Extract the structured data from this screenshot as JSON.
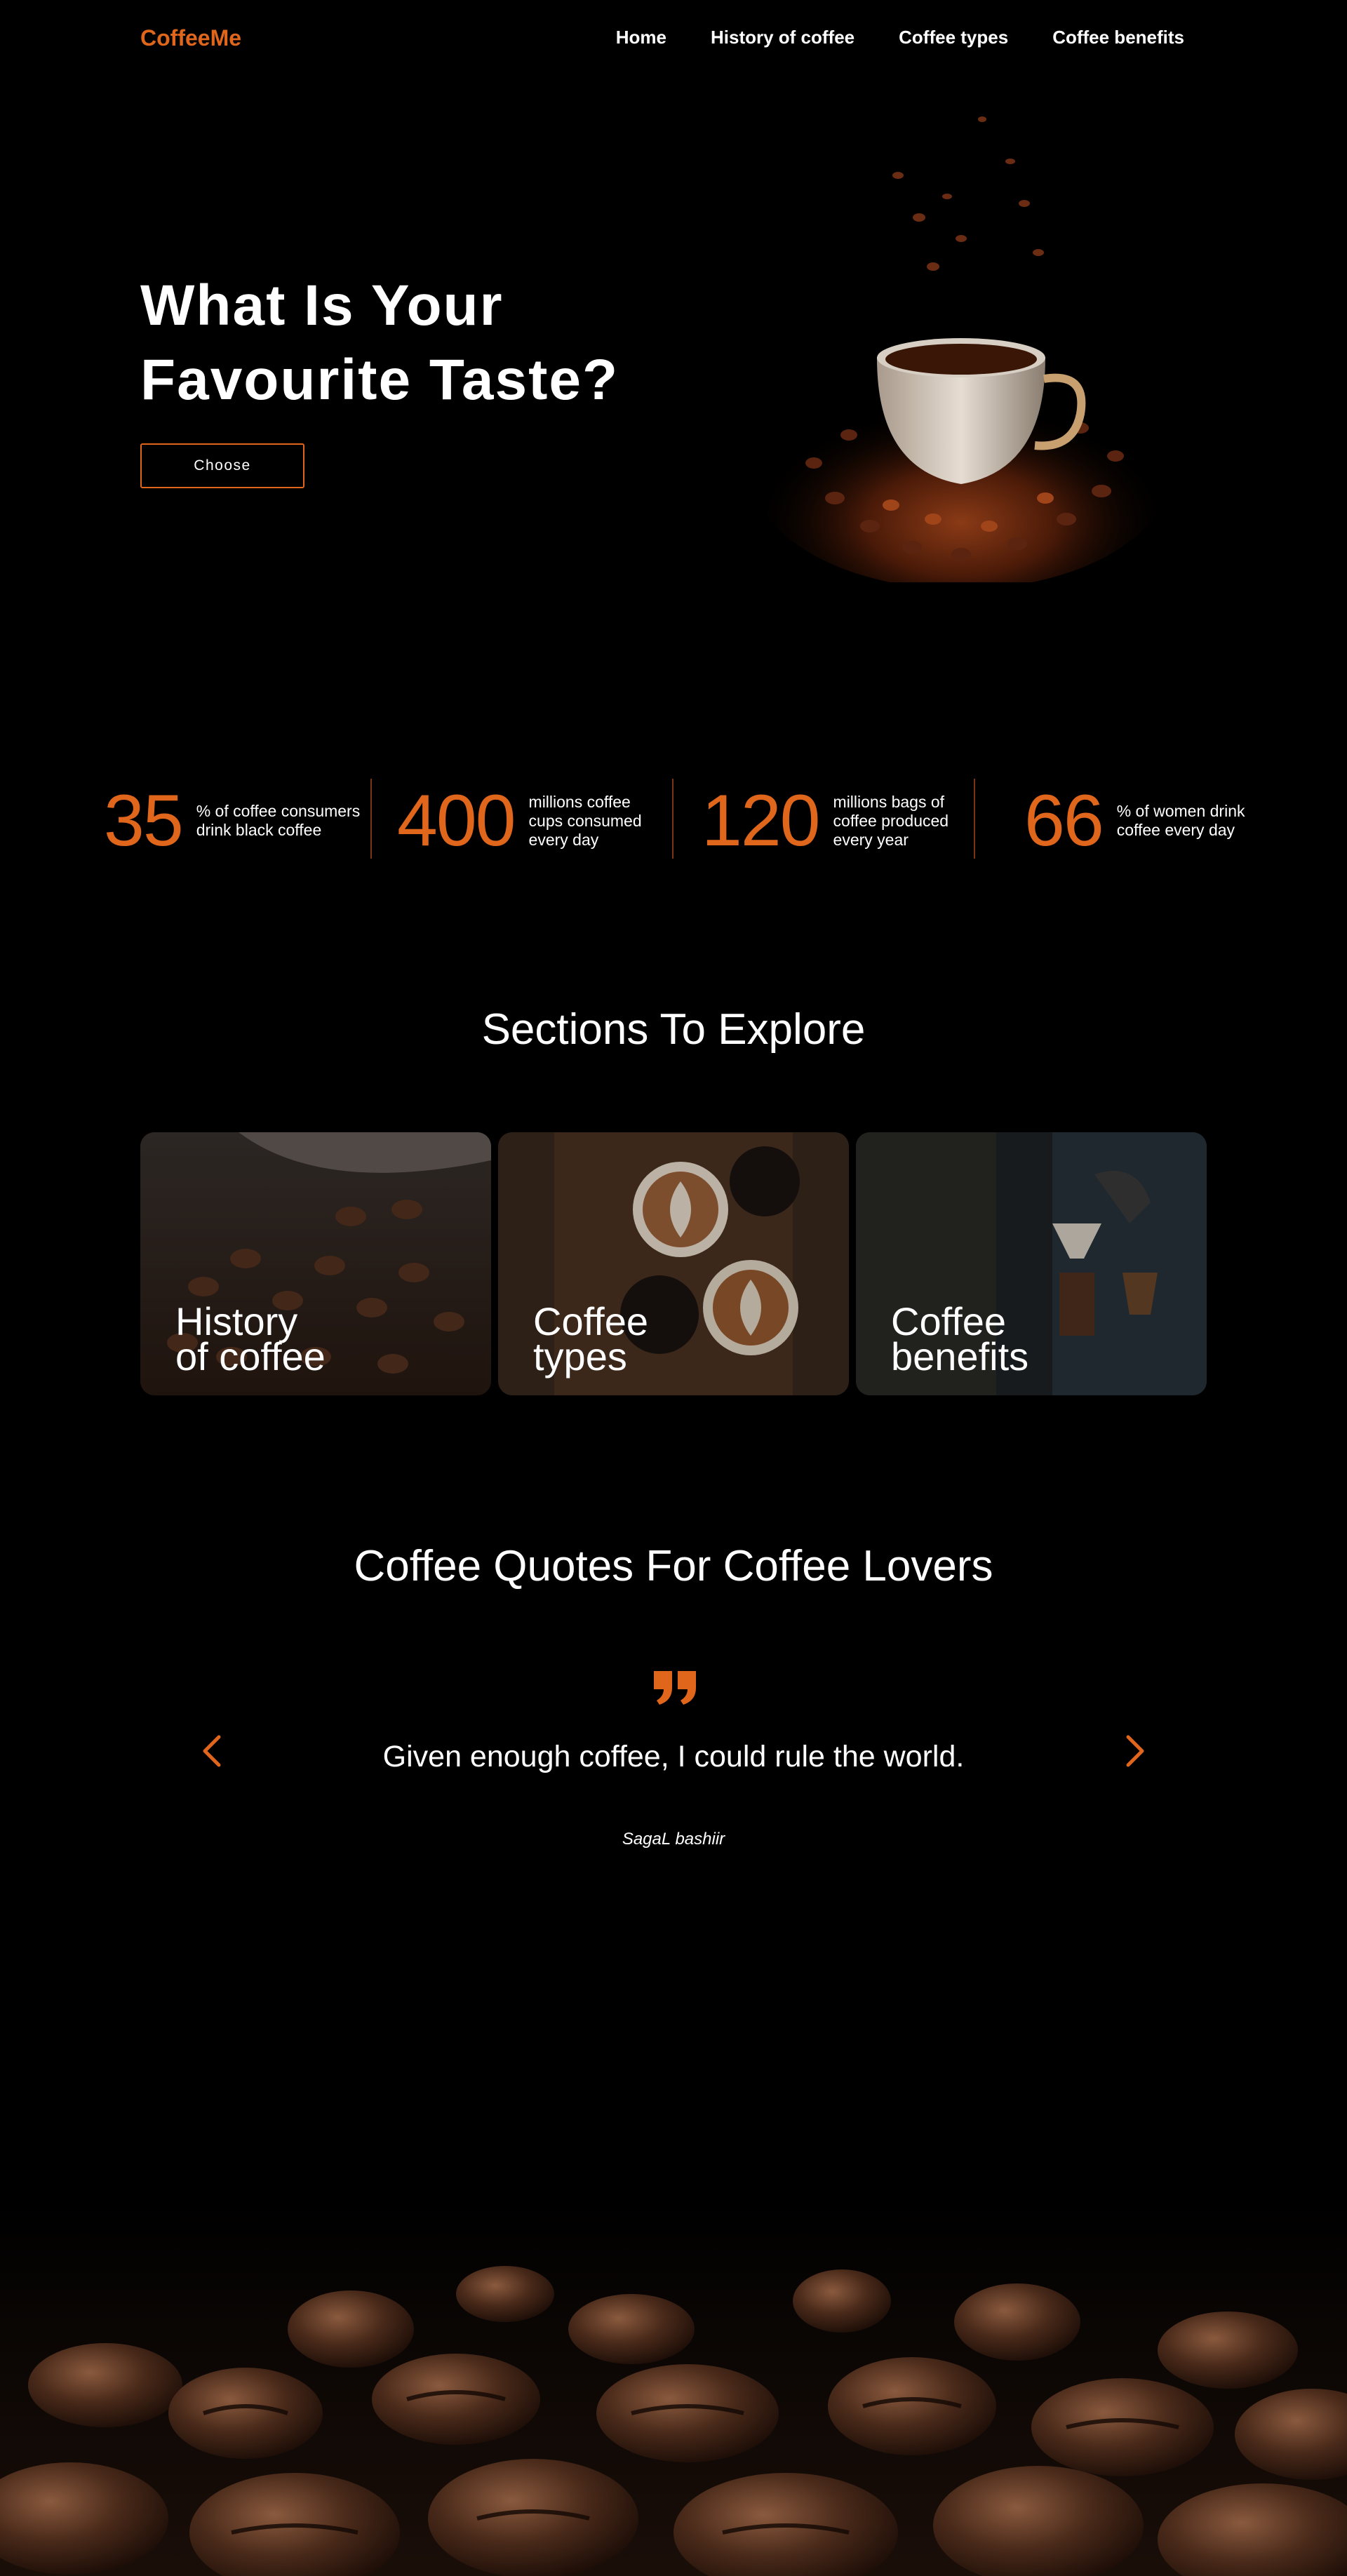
{
  "nav": {
    "brand": "CoffeeMe",
    "links": [
      "Home",
      "History of coffee",
      "Coffee types",
      "Coffee benefits"
    ]
  },
  "hero": {
    "title_line1": "What Is Your",
    "title_line2": "Favourite Taste?",
    "button_label": "Choose"
  },
  "stats": [
    {
      "value": "35",
      "text": "% of coffee consumers drink black coffee"
    },
    {
      "value": "400",
      "text": "millions coffee cups consumed every day"
    },
    {
      "value": "120",
      "text": "millions bags of coffee produced every year"
    },
    {
      "value": "66",
      "text": "% of women drink coffee every day"
    }
  ],
  "sections": {
    "title": "Sections To Explore",
    "cards": [
      {
        "line1": "History",
        "line2": "of coffee"
      },
      {
        "line1": "Coffee",
        "line2": "types"
      },
      {
        "line1": "Coffee",
        "line2": "benefits"
      }
    ]
  },
  "quotes": {
    "title": "Coffee Quotes For Coffee Lovers",
    "text": "Given enough coffee, I could rule the world.",
    "author": "SagaL bashiir"
  },
  "colors": {
    "accent": "#e0661c",
    "background": "#000000",
    "text": "#ffffff"
  },
  "icons": [
    "quote-icon",
    "chevron-left-icon",
    "chevron-right-icon"
  ]
}
